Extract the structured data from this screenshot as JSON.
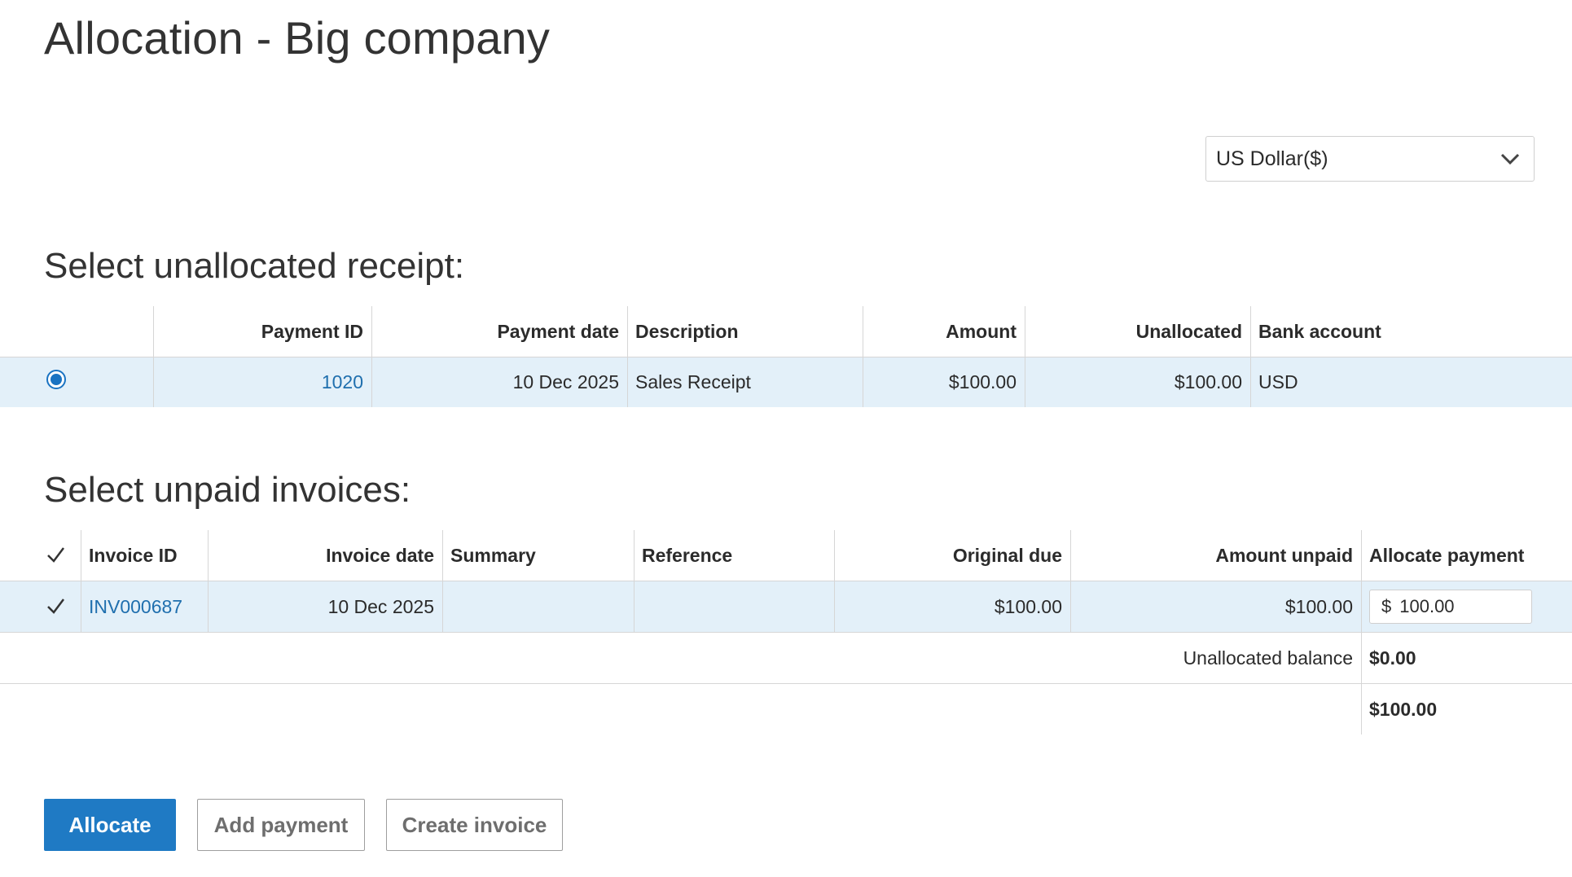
{
  "page": {
    "title": "Allocation - Big company"
  },
  "currency": {
    "selected": "US Dollar($)",
    "icon": "chevron-down-icon"
  },
  "receipts": {
    "title": "Select unallocated receipt:",
    "columns": [
      "Payment ID",
      "Payment date",
      "Description",
      "Amount",
      "Unallocated",
      "Bank account"
    ],
    "rows": [
      {
        "selected": true,
        "payment_id": "1020",
        "payment_date": "10 Dec 2025",
        "description": "Sales Receipt",
        "amount": "$100.00",
        "unallocated": "$100.00",
        "bank_account": "USD"
      }
    ]
  },
  "invoices": {
    "title": "Select unpaid invoices:",
    "select_all_checked": true,
    "columns": [
      "Invoice ID",
      "Invoice date",
      "Summary",
      "Reference",
      "Original due",
      "Amount unpaid",
      "Allocate payment"
    ],
    "rows": [
      {
        "checked": true,
        "invoice_id": "INV000687",
        "invoice_date": "10 Dec 2025",
        "summary": "",
        "reference": "",
        "original_due": "$100.00",
        "amount_unpaid": "$100.00",
        "allocate_currency": "$",
        "allocate_value": "100.00"
      }
    ],
    "unallocated_balance_label": "Unallocated balance",
    "unallocated_balance_value": "$0.00",
    "total_value": "$100.00"
  },
  "actions": {
    "allocate": "Allocate",
    "add_payment": "Add payment",
    "create_invoice": "Create invoice"
  },
  "colors": {
    "primary": "#1f7ac4",
    "link": "#1f6fae",
    "selected_row": "#e3f0f9"
  }
}
